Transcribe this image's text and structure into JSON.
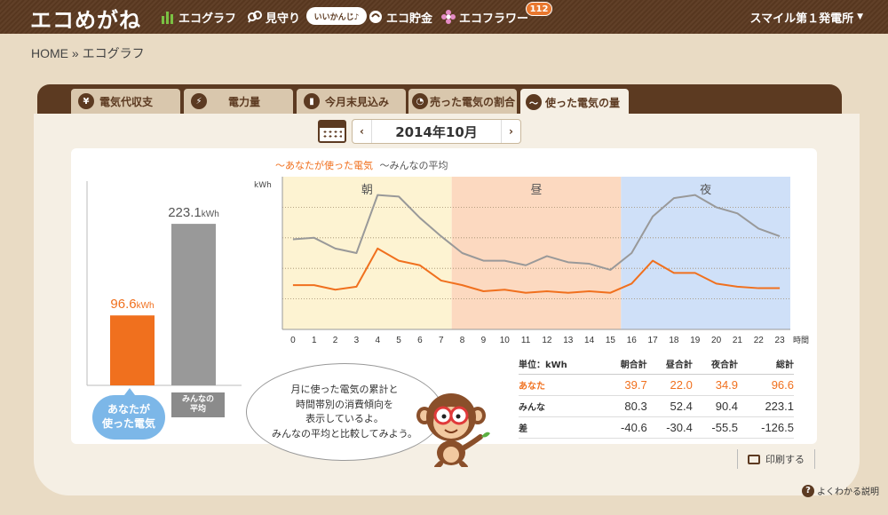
{
  "header": {
    "logo": "エコめがね",
    "nav": [
      {
        "label": "エコグラフ",
        "icon": "bar-chart-icon"
      },
      {
        "label": "見守り",
        "icon": "binoculars-icon"
      },
      {
        "label": "エコ貯金",
        "icon": "coin-icon"
      },
      {
        "label": "エコフラワー",
        "icon": "flower-icon"
      }
    ],
    "watch_bubble": "いいかんじ♪",
    "flower_badge": "112",
    "plant": "スマイル第１発電所"
  },
  "breadcrumb": "HOME » エコグラフ",
  "tabs": [
    {
      "label": "電気代収支",
      "icon": "yen-icon"
    },
    {
      "label": "電力量",
      "icon": "lightning-icon"
    },
    {
      "label": "今月末見込み",
      "icon": "bars-icon"
    },
    {
      "label": "売った電気の割合",
      "icon": "pie-icon"
    },
    {
      "label": "使った電気の量",
      "icon": "wave-icon"
    }
  ],
  "month": {
    "prev": "‹",
    "label": "2014年10月",
    "next": "›"
  },
  "legend": {
    "you": "〜あなたが使った電気",
    "avg": "〜みんなの平均"
  },
  "speech": [
    "月に使った電気の累計と",
    "時間帯別の消費傾向を",
    "表示しているよ。",
    "みんなの平均と比較してみよう。"
  ],
  "badges": {
    "you": [
      "あなたが",
      "使った電気"
    ],
    "avg": [
      "みんなの",
      "平均"
    ]
  },
  "table": {
    "headers": [
      "単位：kWh",
      "朝合計",
      "昼合計",
      "夜合計",
      "総計"
    ],
    "rows": [
      {
        "label": "あなた",
        "values": [
          "39.7",
          "22.0",
          "34.9",
          "96.6"
        ]
      },
      {
        "label": "みんな",
        "values": [
          "80.3",
          "52.4",
          "90.4",
          "223.1"
        ]
      },
      {
        "label": "差",
        "values": [
          "-40.6",
          "-30.4",
          "-55.5",
          "-126.5"
        ]
      }
    ]
  },
  "actions": {
    "print": "印刷する",
    "help": "よくわかる説明",
    "help_icon": "?"
  },
  "colors": {
    "brand": "#5c3a21",
    "you": "#f0701e",
    "avg": "#999999",
    "morning": "#fdf3d2",
    "noon": "#fcd9c0",
    "night": "#cfe0f8"
  },
  "chart_data": [
    {
      "type": "bar",
      "categories": [
        "あなたが使った電気",
        "みんなの平均"
      ],
      "values": [
        96.6,
        223.1
      ],
      "unit": "kWh",
      "value_labels": [
        "96.6",
        "223.1"
      ],
      "ylim": [
        0,
        260
      ]
    },
    {
      "type": "line",
      "x": [
        0,
        1,
        2,
        3,
        4,
        5,
        6,
        7,
        8,
        9,
        10,
        11,
        12,
        13,
        14,
        15,
        16,
        17,
        18,
        19,
        20,
        21,
        22,
        23
      ],
      "xlabel": "時間",
      "ylabel": "kWh",
      "bands": [
        {
          "label": "朝",
          "from": 0,
          "to": 8
        },
        {
          "label": "昼",
          "from": 8,
          "to": 16
        },
        {
          "label": "夜",
          "from": 16,
          "to": 24
        }
      ],
      "ylim": [
        0,
        10
      ],
      "grid": true,
      "series": [
        {
          "name": "あなたが使った電気",
          "color": "#f0701e",
          "values": [
            2.9,
            2.9,
            2.6,
            2.8,
            5.3,
            4.5,
            4.2,
            3.2,
            2.9,
            2.5,
            2.6,
            2.4,
            2.5,
            2.4,
            2.5,
            2.4,
            3.0,
            4.5,
            3.7,
            3.7,
            3.0,
            2.8,
            2.7,
            2.7
          ]
        },
        {
          "name": "みんなの平均",
          "color": "#999999",
          "values": [
            5.9,
            6.0,
            5.3,
            5.0,
            8.8,
            8.7,
            7.3,
            6.1,
            5.0,
            4.5,
            4.5,
            4.2,
            4.8,
            4.4,
            4.3,
            3.9,
            5.0,
            7.4,
            8.6,
            8.8,
            8.0,
            7.6,
            6.6,
            6.1
          ]
        }
      ]
    }
  ]
}
